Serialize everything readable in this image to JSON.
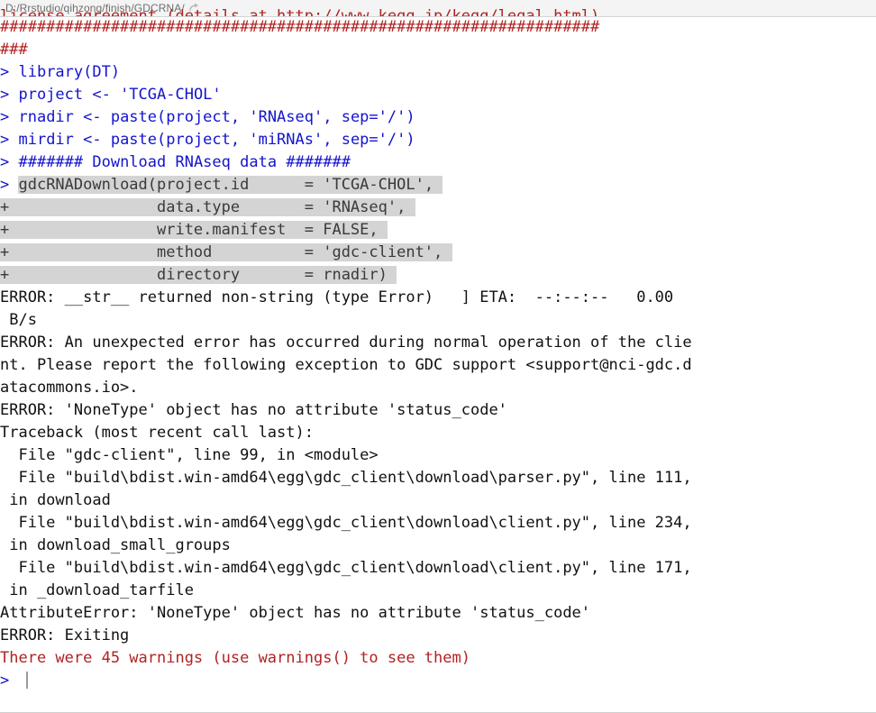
{
  "titlebar": {
    "path": "D:/Rrstudio/qihzong/finish/GDCRNA/",
    "icon": "open-in-new-window-icon"
  },
  "console": {
    "colors": {
      "message_red": "#b22222",
      "code_blue": "#1414cd",
      "output_black": "#111111",
      "selection_bg": "#d4d4d4",
      "background": "#ffffff"
    },
    "lines": [
      {
        "id": "l00",
        "kind": "message",
        "clipped": true,
        "text": "license agreement (details at http://www.kegg.jp/kegg/legal.html)"
      },
      {
        "id": "l01",
        "kind": "message",
        "text": "#################################################################"
      },
      {
        "id": "l02",
        "kind": "message",
        "text": "###"
      },
      {
        "id": "l03",
        "kind": "input",
        "prompt": "> ",
        "text": "library(DT)"
      },
      {
        "id": "l04",
        "kind": "input",
        "prompt": "> ",
        "text": "project <- 'TCGA-CHOL'"
      },
      {
        "id": "l05",
        "kind": "input",
        "prompt": "> ",
        "text": "rnadir <- paste(project, 'RNAseq', sep='/')"
      },
      {
        "id": "l06",
        "kind": "input",
        "prompt": "> ",
        "text": "mirdir <- paste(project, 'miRNAs', sep='/')"
      },
      {
        "id": "l07",
        "kind": "input",
        "prompt": "> ",
        "text": "####### Download RNAseq data #######"
      },
      {
        "id": "l08",
        "kind": "input-selected",
        "prompt": "> ",
        "text": "gdcRNADownload(project.id      = 'TCGA-CHOL',"
      },
      {
        "id": "l09",
        "kind": "continuation-selected",
        "prompt": "+ ",
        "text": "               data.type       = 'RNAseq',"
      },
      {
        "id": "l10",
        "kind": "continuation-selected",
        "prompt": "+ ",
        "text": "               write.manifest  = FALSE,"
      },
      {
        "id": "l11",
        "kind": "continuation-selected",
        "prompt": "+ ",
        "text": "               method          = 'gdc-client',"
      },
      {
        "id": "l12",
        "kind": "continuation-selected",
        "prompt": "+ ",
        "text": "               directory       = rnadir)"
      },
      {
        "id": "l13",
        "kind": "output",
        "text": "ERROR: __str__ returned non-string (type Error)   ] ETA:  --:--:--   0.00"
      },
      {
        "id": "l14",
        "kind": "output",
        "text": " B/s"
      },
      {
        "id": "l15",
        "kind": "output",
        "text": "ERROR: An unexpected error has occurred during normal operation of the clie"
      },
      {
        "id": "l16",
        "kind": "output",
        "text": "nt. Please report the following exception to GDC support <support@nci-gdc.d"
      },
      {
        "id": "l17",
        "kind": "output",
        "text": "atacommons.io>."
      },
      {
        "id": "l18",
        "kind": "output",
        "text": "ERROR: 'NoneType' object has no attribute 'status_code'"
      },
      {
        "id": "l19",
        "kind": "output",
        "text": "Traceback (most recent call last):"
      },
      {
        "id": "l20",
        "kind": "output",
        "text": "  File \"gdc-client\", line 99, in <module>"
      },
      {
        "id": "l21",
        "kind": "output",
        "text": "  File \"build\\bdist.win-amd64\\egg\\gdc_client\\download\\parser.py\", line 111,"
      },
      {
        "id": "l22",
        "kind": "output",
        "text": " in download"
      },
      {
        "id": "l23",
        "kind": "output",
        "text": "  File \"build\\bdist.win-amd64\\egg\\gdc_client\\download\\client.py\", line 234,"
      },
      {
        "id": "l24",
        "kind": "output",
        "text": " in download_small_groups"
      },
      {
        "id": "l25",
        "kind": "output",
        "text": "  File \"build\\bdist.win-amd64\\egg\\gdc_client\\download\\client.py\", line 171,"
      },
      {
        "id": "l26",
        "kind": "output",
        "text": " in _download_tarfile"
      },
      {
        "id": "l27",
        "kind": "output",
        "text": "AttributeError: 'NoneType' object has no attribute 'status_code'"
      },
      {
        "id": "l28",
        "kind": "output",
        "text": "ERROR: Exiting"
      },
      {
        "id": "l29",
        "kind": "message",
        "text": "There were 45 warnings (use warnings() to see them)"
      },
      {
        "id": "l30",
        "kind": "prompt-active",
        "prompt": "> ",
        "text": ""
      }
    ]
  }
}
